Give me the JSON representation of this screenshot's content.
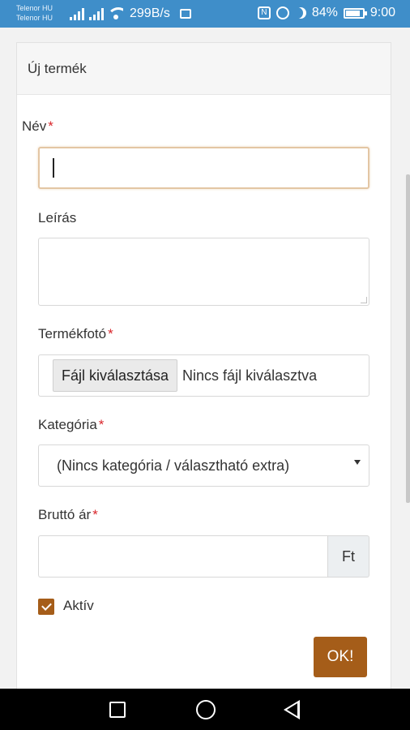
{
  "status_bar": {
    "carrier_1": "Telenor HU",
    "carrier_2": "Telenor HU",
    "speed": "299B/s",
    "battery": "84%",
    "time": "9:00"
  },
  "card": {
    "title": "Új termék"
  },
  "form": {
    "name_label": "Név",
    "required_mark": "*",
    "name_value": "",
    "description_label": "Leírás",
    "description_value": "",
    "photo_label": "Termékfotó",
    "file_button_label": "Fájl kiválasztása",
    "file_status": "Nincs fájl kiválasztva",
    "category_label": "Kategória",
    "category_selected": "(Nincs kategória / választható extra)",
    "price_label": "Bruttó ár",
    "price_value": "",
    "currency": "Ft",
    "active_label": "Aktív",
    "active_checked": true,
    "submit_label": "OK!"
  },
  "colors": {
    "status_bar": "#3f8ec9",
    "accent": "#a55d19",
    "required": "#d9262b"
  }
}
